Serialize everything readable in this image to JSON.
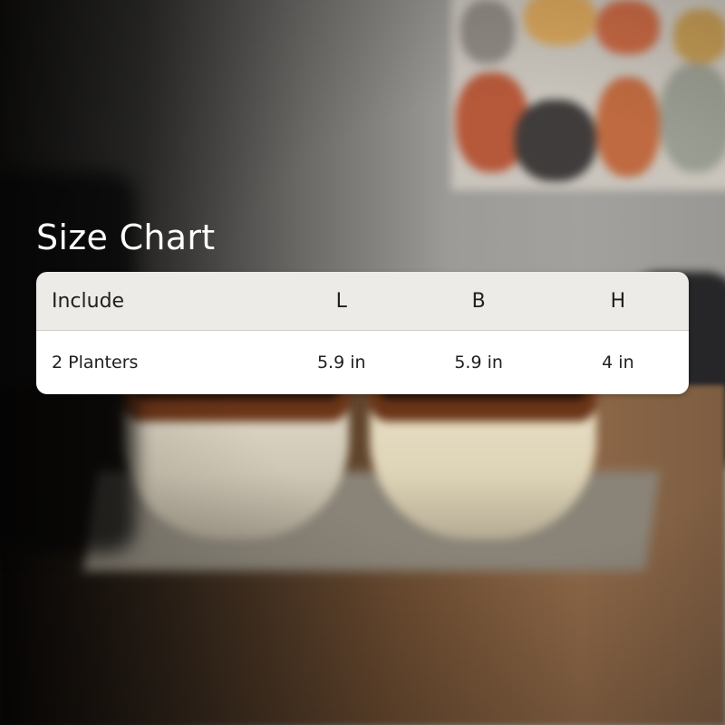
{
  "title": "Size Chart",
  "table": {
    "headers": [
      "Include",
      "L",
      "B",
      "H"
    ],
    "rows": [
      [
        "2 Planters",
        "5.9 in",
        "5.9 in",
        "4 in"
      ]
    ]
  },
  "colors": {
    "header_bg": "#edebe7",
    "row_bg": "#ffffff",
    "title_text": "#ffffff",
    "table_text": "#202020"
  }
}
